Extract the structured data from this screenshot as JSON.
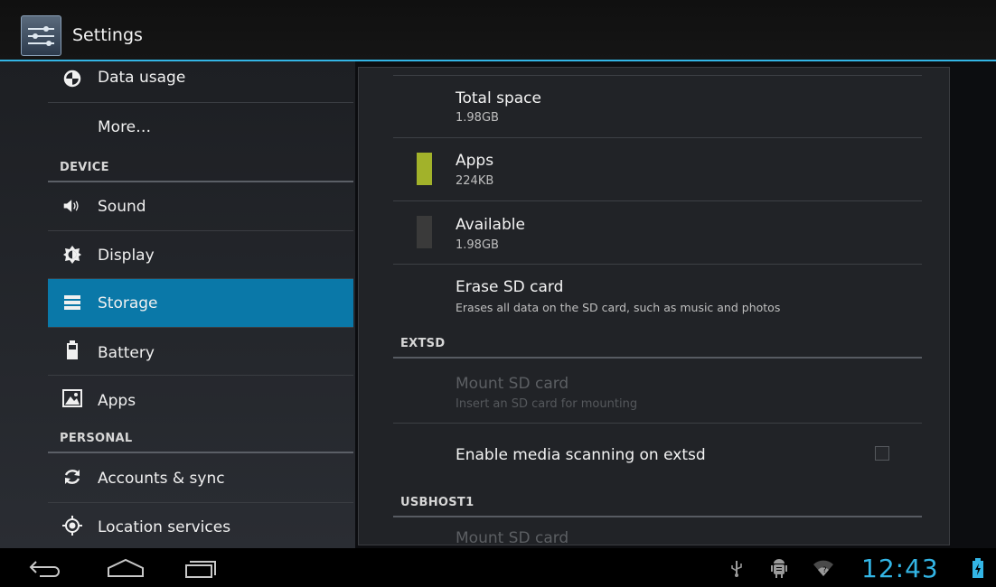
{
  "app": {
    "title": "Settings",
    "icon": "settings-sliders-icon"
  },
  "colors": {
    "accent": "#33b5e5",
    "selected": "#0a78a8",
    "apps_swatch": "#a2b22a",
    "available_swatch": "#3a3a3a"
  },
  "sidebar": {
    "items": [
      {
        "label": "Data usage",
        "icon": "data-usage-icon"
      },
      {
        "label": "More…",
        "icon": ""
      },
      {
        "label": "Sound",
        "icon": "sound-icon"
      },
      {
        "label": "Display",
        "icon": "display-icon"
      },
      {
        "label": "Storage",
        "icon": "storage-icon",
        "selected": true
      },
      {
        "label": "Battery",
        "icon": "battery-icon"
      },
      {
        "label": "Apps",
        "icon": "apps-icon"
      },
      {
        "label": "Accounts & sync",
        "icon": "sync-icon"
      },
      {
        "label": "Location services",
        "icon": "location-icon"
      }
    ],
    "headers": {
      "device": "DEVICE",
      "personal": "PERSONAL"
    }
  },
  "storage": {
    "total": {
      "title": "Total space",
      "value": "1.98GB"
    },
    "apps": {
      "title": "Apps",
      "value": "224KB"
    },
    "available": {
      "title": "Available",
      "value": "1.98GB"
    },
    "erase": {
      "title": "Erase SD card",
      "subtitle": "Erases all data on the SD card, such as music and photos"
    },
    "extsd_header": "EXTSD",
    "mount": {
      "title": "Mount SD card",
      "subtitle": "Insert an SD card for mounting"
    },
    "media_scan": {
      "title": "Enable media scanning on extsd",
      "checked": false
    },
    "usbhost_header": "USBHOST1",
    "mount2": {
      "title": "Mount SD card"
    }
  },
  "navbar": {
    "back": "back-icon",
    "home": "home-icon",
    "recents": "recents-icon"
  },
  "status": {
    "time": "12:43",
    "icons": [
      "usb-icon",
      "android-debug-icon",
      "wifi-icon",
      "battery-charging-icon"
    ]
  }
}
